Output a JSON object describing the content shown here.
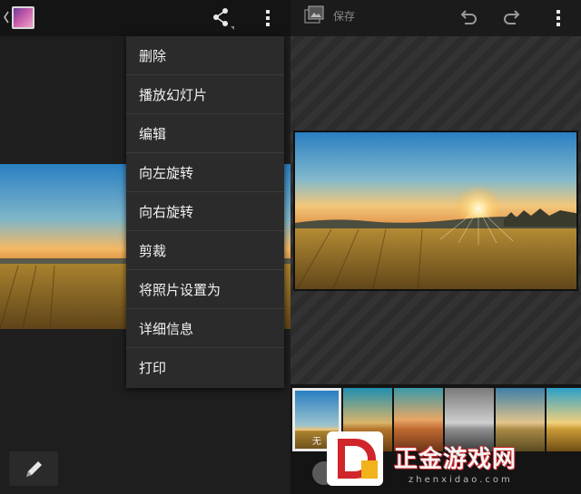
{
  "left_panel": {
    "menu_items": [
      {
        "label": "删除"
      },
      {
        "label": "播放幻灯片"
      },
      {
        "label": "编辑"
      },
      {
        "label": "向左旋转"
      },
      {
        "label": "向右旋转"
      },
      {
        "label": "剪裁"
      },
      {
        "label": "将照片设置为"
      },
      {
        "label": "详细信息"
      },
      {
        "label": "打印"
      }
    ],
    "icons": {
      "back": "chevron-left-icon",
      "app": "gallery-app-icon",
      "share": "share-icon",
      "overflow": "overflow-menu-icon",
      "edit": "pencil-icon"
    }
  },
  "right_panel": {
    "toolbar": {
      "save_label": "保存",
      "icons": [
        "save-photo-icon",
        "undo-icon",
        "redo-icon",
        "overflow-menu-icon"
      ]
    },
    "filters": [
      {
        "label": "无",
        "selected": true
      },
      {
        "label": "",
        "selected": false
      },
      {
        "label": "",
        "selected": false
      },
      {
        "label": "",
        "selected": false
      },
      {
        "label": "",
        "selected": false
      },
      {
        "label": "",
        "selected": false
      }
    ]
  },
  "watermark": {
    "text": "正金游戏网",
    "sub": "zhenxidao.com"
  },
  "colors": {
    "sky_top": "#2a7fc2",
    "sky_horizon": "#f3b964",
    "field": "#8a6a2b",
    "menu_bg": "#2b2b2b",
    "accent_red": "#d0262b"
  }
}
